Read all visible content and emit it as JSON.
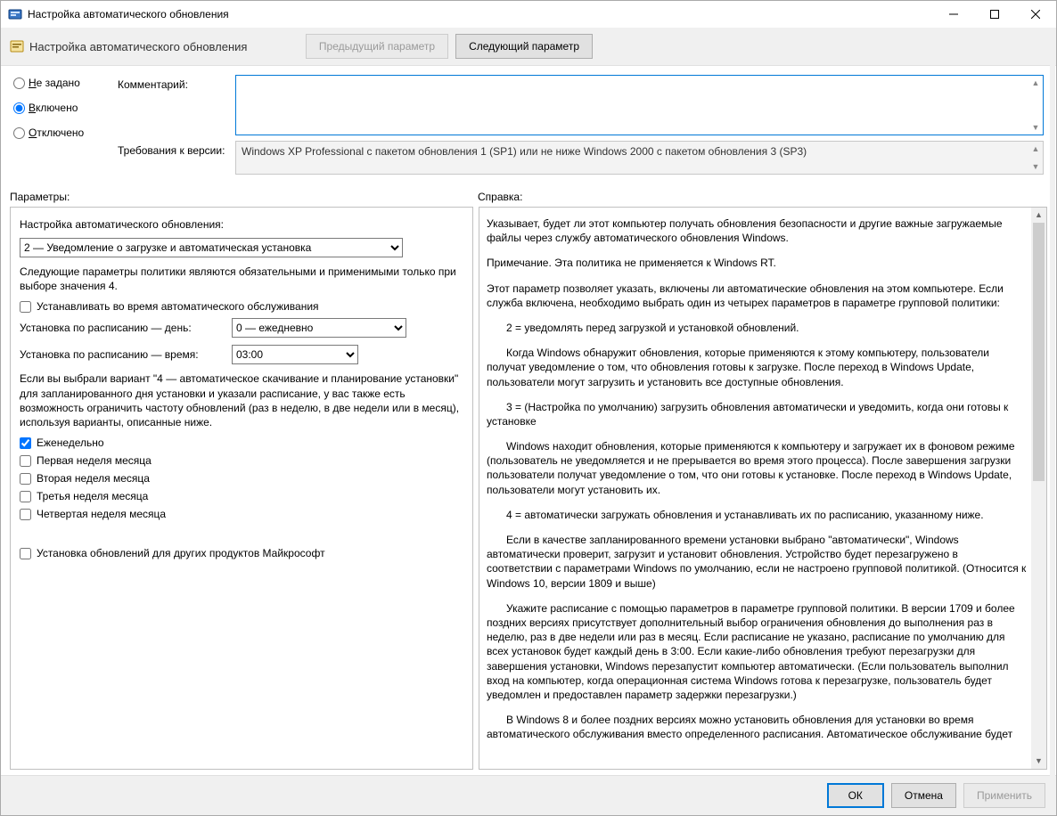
{
  "window": {
    "title": "Настройка автоматического обновления"
  },
  "toolbar": {
    "policy_title": "Настройка автоматического обновления",
    "prev": "Предыдущий параметр",
    "next": "Следующий параметр"
  },
  "state": {
    "not_configured": "Не задано",
    "enabled": "Включено",
    "disabled": "Отключено",
    "selected": "enabled"
  },
  "labels": {
    "comment": "Комментарий:",
    "supported": "Требования к версии:",
    "options": "Параметры:",
    "help": "Справка:"
  },
  "comment_value": "",
  "supported_value": "Windows XP Professional с пакетом обновления 1 (SP1) или не ниже Windows 2000 с пакетом обновления 3 (SP3)",
  "options": {
    "heading": "Настройка автоматического обновления:",
    "update_mode": "2 — Уведомление о загрузке и автоматическая установка",
    "note1": "Следующие параметры политики являются обязательными и применимыми только при выборе значения 4.",
    "maint_cb": "Устанавливать во время автоматического обслуживания",
    "day_label": "Установка по расписанию — день:",
    "day_value": "0 — ежедневно",
    "time_label": "Установка по расписанию — время:",
    "time_value": "03:00",
    "note2": "Если вы выбрали вариант \"4 — автоматическое скачивание и планирование установки\" для запланированного дня установки и указали расписание, у вас также есть возможность ограничить частоту обновлений (раз в неделю, в две недели или в месяц), используя варианты, описанные ниже.",
    "weekly": "Еженедельно",
    "week1": "Первая неделя месяца",
    "week2": "Вторая неделя месяца",
    "week3": "Третья неделя месяца",
    "week4": "Четвертая неделя месяца",
    "other_ms": "Установка обновлений для других продуктов Майкрософт",
    "weekly_checked": true
  },
  "help": {
    "p1": "Указывает, будет ли этот компьютер получать обновления безопасности и другие важные загружаемые файлы через службу автоматического обновления Windows.",
    "p2": "Примечание. Эта политика не применяется к Windows RT.",
    "p3": "Этот параметр позволяет указать, включены ли автоматические обновления на этом компьютере. Если служба включена, необходимо выбрать один из четырех параметров в параметре групповой политики:",
    "p4": "2 = уведомлять перед загрузкой и установкой обновлений.",
    "p5": "Когда Windows обнаружит обновления, которые применяются к этому компьютеру, пользователи получат уведомление о том, что обновления готовы к загрузке. После переход в Windows Update, пользователи могут загрузить и установить все доступные обновления.",
    "p6": "3 = (Настройка по умолчанию) загрузить обновления автоматически и уведомить, когда они готовы к установке",
    "p7": "Windows находит обновления, которые применяются к компьютеру и загружает их в фоновом режиме (пользователь не уведомляется и не прерывается во время этого процесса). После завершения загрузки пользователи получат уведомление о том, что они готовы к установке. После переход в Windows Update, пользователи могут установить их.",
    "p8": "4 = автоматически загружать обновления и устанавливать их по расписанию, указанному ниже.",
    "p9": "Если в качестве запланированного времени установки выбрано \"автоматически\", Windows автоматически проверит, загрузит и установит обновления. Устройство будет перезагружено в соответствии с параметрами Windows по умолчанию, если не настроено групповой политикой. (Относится к Windows 10, версии 1809 и выше)",
    "p10": "Укажите расписание с помощью параметров в параметре групповой политики. В версии 1709 и более поздних версиях присутствует дополнительный выбор ограничения обновления до выполнения раз в неделю, раз в две недели или раз в месяц. Если расписание не указано, расписание по умолчанию для всех установок будет каждый день в 3:00. Если какие-либо обновления требуют перезагрузки для завершения установки, Windows перезапустит компьютер автоматически. (Если пользователь выполнил вход на компьютер, когда операционная система Windows готова к перезагрузке, пользователь будет уведомлен и предоставлен параметр задержки перезагрузки.)",
    "p11": "В Windows 8 и более поздних версиях можно установить обновления для установки во время автоматического обслуживания вместо определенного расписания. Автоматическое обслуживание будет"
  },
  "footer": {
    "ok": "ОК",
    "cancel": "Отмена",
    "apply": "Применить"
  }
}
